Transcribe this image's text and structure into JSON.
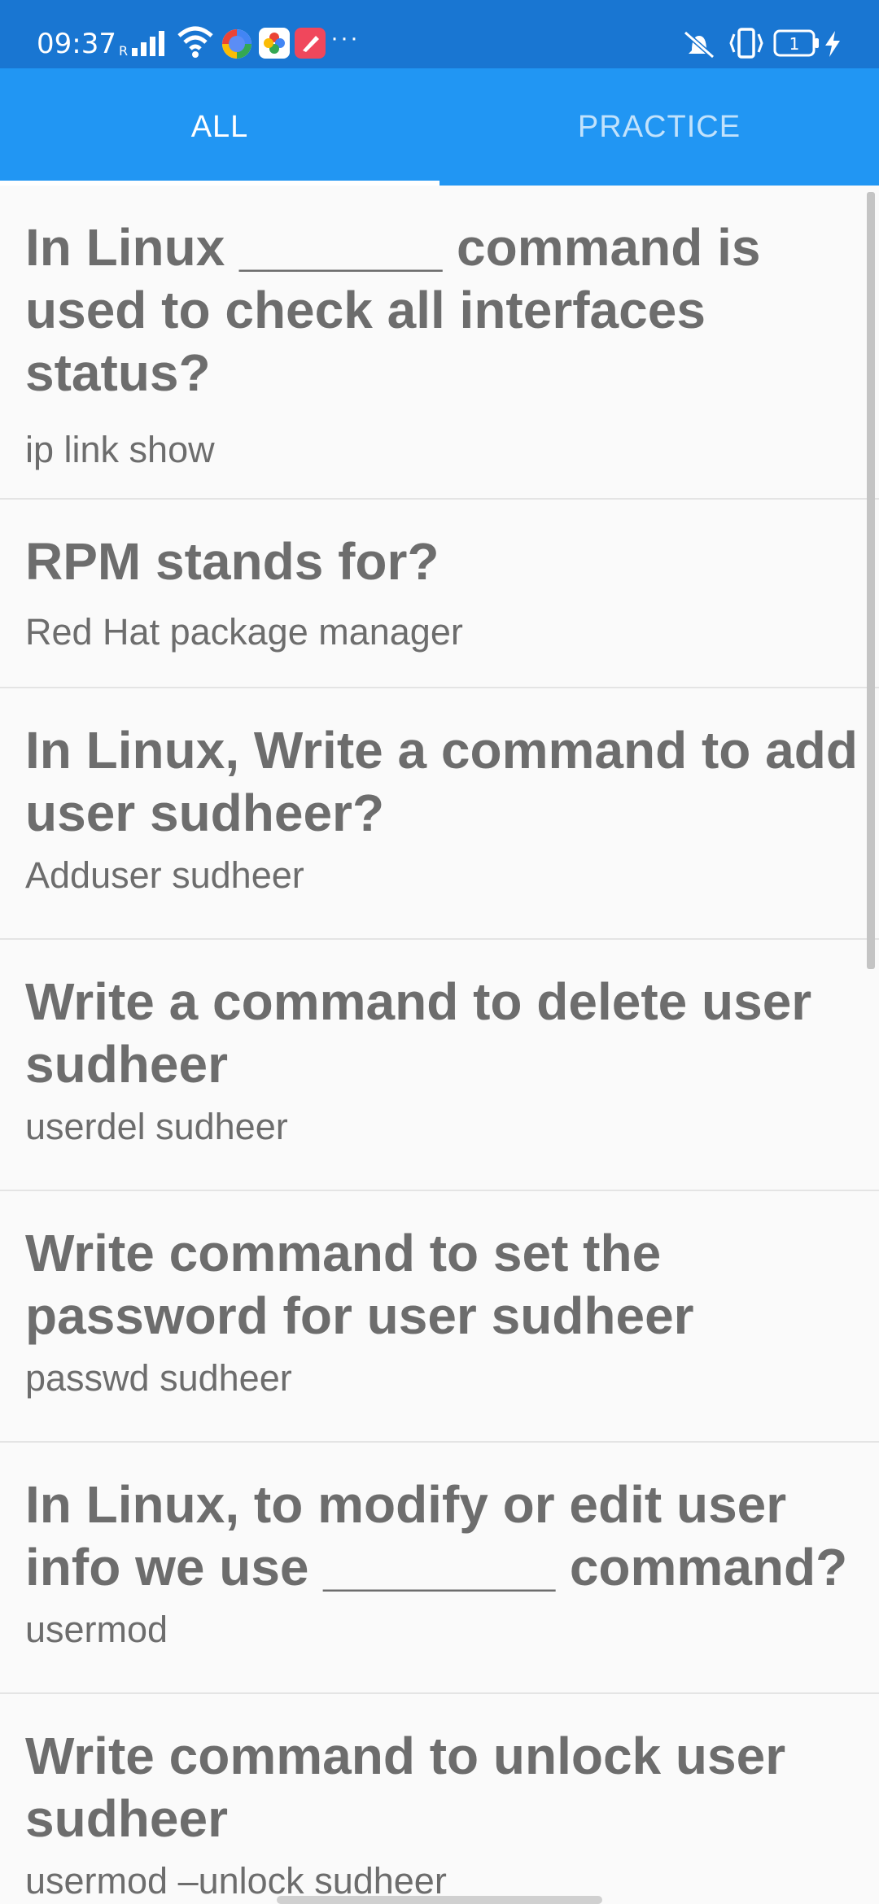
{
  "status_bar": {
    "time": "09:37",
    "more_indicator": "···",
    "battery_level": "1",
    "icons": [
      "signal-icon",
      "wifi-icon",
      "gpay-icon",
      "photos-icon",
      "app-icon",
      "vibrate-mute-icon",
      "vibrate-icon",
      "battery-icon",
      "charging-icon"
    ]
  },
  "tabs": [
    {
      "label": "ALL",
      "selected": true
    },
    {
      "label": "PRACTICE",
      "selected": false
    }
  ],
  "items": [
    {
      "question": "In Linux _______ command is used to check all interfaces status?",
      "answer": "ip link show"
    },
    {
      "question": "RPM stands for?",
      "answer": "Red Hat package manager"
    },
    {
      "question": "In Linux, Write a command to add user sudheer?",
      "answer": "Adduser sudheer"
    },
    {
      "question": "Write a command to delete user sudheer",
      "answer": "userdel sudheer"
    },
    {
      "question": "Write command to set the password for user sudheer",
      "answer": "passwd sudheer"
    },
    {
      "question": "In Linux, to modify or edit user info we use ________ command?",
      "answer": "usermod"
    },
    {
      "question": "Write command to unlock user sudheer",
      "answer": "usermod –unlock sudheer"
    }
  ],
  "colors": {
    "status_bar": "#1976d2",
    "tab_bar": "#2196f3",
    "text": "#6d6d6d",
    "background": "#fafafa"
  }
}
